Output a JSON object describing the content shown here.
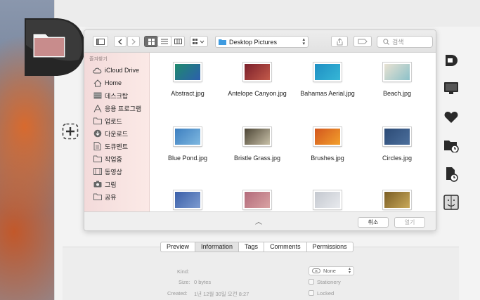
{
  "toolbar": {
    "path_label": "Desktop Pictures",
    "search_placeholder": "검색"
  },
  "sidebar": {
    "heading": "즐겨찾기",
    "items": [
      {
        "label": "iCloud Drive",
        "icon": "cloud-icon"
      },
      {
        "label": "Home",
        "icon": "home-icon"
      },
      {
        "label": "데스크탑",
        "icon": "desktop-icon"
      },
      {
        "label": "응용 프로그램",
        "icon": "applications-icon"
      },
      {
        "label": "업로드",
        "icon": "folder-icon"
      },
      {
        "label": "다운로드",
        "icon": "download-icon"
      },
      {
        "label": "도큐멘트",
        "icon": "document-icon"
      },
      {
        "label": "작업중",
        "icon": "folder-icon"
      },
      {
        "label": "동영상",
        "icon": "movies-icon"
      },
      {
        "label": "그림",
        "icon": "camera-icon"
      },
      {
        "label": "공유",
        "icon": "folder-icon"
      }
    ]
  },
  "files": [
    {
      "name": "Abstract.jpg",
      "colors": [
        "#1f8a6d",
        "#2c5fae"
      ]
    },
    {
      "name": "Antelope Canyon.jpg",
      "colors": [
        "#7a1f2a",
        "#c35a4a"
      ]
    },
    {
      "name": "Bahamas Aerial.jpg",
      "colors": [
        "#1f8fc3",
        "#36b6d6"
      ]
    },
    {
      "name": "Beach.jpg",
      "colors": [
        "#e9e2d2",
        "#8cc1c9"
      ]
    },
    {
      "name": "Blue Pond.jpg",
      "colors": [
        "#3d7fc0",
        "#7fb8e0"
      ]
    },
    {
      "name": "Bristle Grass.jpg",
      "colors": [
        "#4d4636",
        "#c8c0a8"
      ]
    },
    {
      "name": "Brushes.jpg",
      "colors": [
        "#d2561e",
        "#f3a02c"
      ]
    },
    {
      "name": "Circles.jpg",
      "colors": [
        "#2c4b76",
        "#4c6f9c"
      ]
    },
    {
      "name": "",
      "colors": [
        "#3a5fa8",
        "#7d9bd0"
      ]
    },
    {
      "name": "",
      "colors": [
        "#b26a7a",
        "#d9a2a3"
      ]
    },
    {
      "name": "",
      "colors": [
        "#c4c8cf",
        "#e8eaee"
      ]
    },
    {
      "name": "",
      "colors": [
        "#7a5d24",
        "#c9a95a"
      ]
    }
  ],
  "bottom": {
    "cancel_label": "취소",
    "open_label": "열기"
  },
  "info_tabs": [
    {
      "label": "Preview",
      "selected": false
    },
    {
      "label": "Information",
      "selected": true
    },
    {
      "label": "Tags",
      "selected": false
    },
    {
      "label": "Comments",
      "selected": false
    },
    {
      "label": "Permissions",
      "selected": false
    }
  ],
  "info": {
    "kind_label": "Kind:",
    "size_label": "Size:",
    "size_value": "0 bytes",
    "created_label": "Created:",
    "created_value": "1년 12월 30일 오전 8:27",
    "label_value": "None",
    "stationery_label": "Stationery",
    "locked_label": "Locked"
  },
  "colors": {
    "brand": "#2b2b2b",
    "sidebar_tint": "#f6dedd",
    "folder_blue": "#3f9be0"
  }
}
